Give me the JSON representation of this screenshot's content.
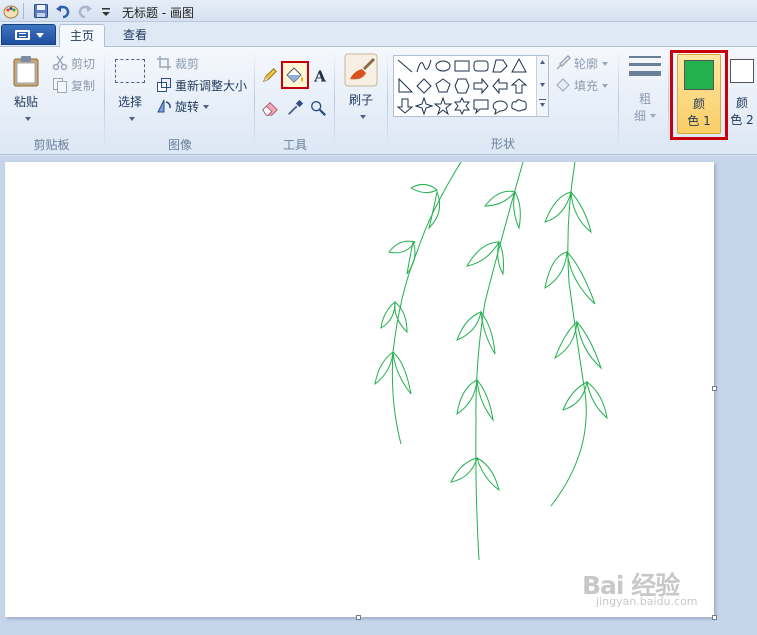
{
  "window": {
    "title": "无标题 - 画图"
  },
  "tabs": [
    {
      "label": "主页",
      "active": true
    },
    {
      "label": "查看",
      "active": false
    }
  ],
  "clipboard": {
    "paste_label": "粘贴",
    "cut_label": "剪切",
    "copy_label": "复制",
    "group_label": "剪贴板"
  },
  "image": {
    "select_label": "选择",
    "crop_label": "裁剪",
    "resize_label": "重新调整大小",
    "rotate_label": "旋转",
    "group_label": "图像"
  },
  "tools": {
    "group_label": "工具",
    "selected_tool": "fill"
  },
  "brushes": {
    "label": "刷子"
  },
  "shapes": {
    "group_label": "形状",
    "outline_label": "轮廓",
    "fill_label": "填充"
  },
  "size": {
    "label_line1": "粗",
    "label_line2": "细"
  },
  "colors": {
    "color1": {
      "label_line1": "颜",
      "label_line2": "色 1",
      "value": "#22b14c"
    },
    "color2": {
      "label_line1": "颜",
      "label_line2": "色 2",
      "value": "#ffffff"
    }
  },
  "watermark": {
    "brand": "Bai 经验",
    "sub": "jingyan.baidu.com"
  }
}
